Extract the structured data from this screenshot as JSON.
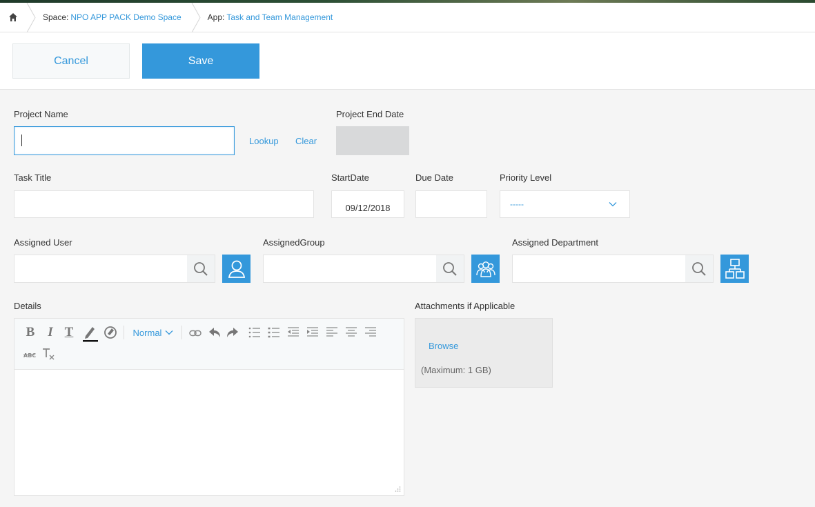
{
  "breadcrumb": {
    "space_prefix": "Space:",
    "space_name": "NPO APP PACK Demo Space",
    "app_prefix": "App:",
    "app_name": "Task and Team Management"
  },
  "actions": {
    "cancel_label": "Cancel",
    "save_label": "Save"
  },
  "form": {
    "project_name": {
      "label": "Project Name",
      "value": "",
      "lookup_label": "Lookup",
      "clear_label": "Clear"
    },
    "project_end_date": {
      "label": "Project End Date",
      "value": ""
    },
    "task_title": {
      "label": "Task Title",
      "value": ""
    },
    "start_date": {
      "label": "StartDate",
      "value": "09/12/2018"
    },
    "due_date": {
      "label": "Due Date",
      "value": ""
    },
    "priority_level": {
      "label": "Priority Level",
      "value": "-----"
    },
    "assigned_user": {
      "label": "Assigned User",
      "value": ""
    },
    "assigned_group": {
      "label": "AssignedGroup",
      "value": ""
    },
    "assigned_department": {
      "label": "Assigned Department",
      "value": ""
    },
    "details": {
      "label": "Details",
      "format_value": "Normal"
    },
    "attachments": {
      "label": "Attachments if Applicable",
      "browse_label": "Browse",
      "max_note": "(Maximum: 1 GB)"
    }
  },
  "colors": {
    "accent": "#3498db",
    "page_bg": "#f5f5f5",
    "readonly_bg": "#d8d9da"
  },
  "icons": [
    "home-icon",
    "search-icon",
    "user-icon",
    "group-icon",
    "department-icon",
    "chevron-down-icon"
  ]
}
